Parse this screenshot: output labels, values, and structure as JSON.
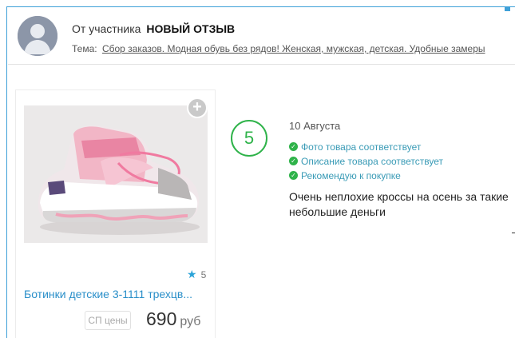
{
  "header": {
    "from_label": "От участника",
    "author": "НОВЫЙ ОТЗЫВ",
    "topic_label": "Тема:",
    "topic_link": "Сбор заказов. Модная обувь без рядов! Женская, мужская, детская. Удобные замеры"
  },
  "product": {
    "rating": "5",
    "title": "Ботинки детские 3-1111 трехцв...",
    "price_badge": "СП цены",
    "price": "690",
    "currency": "руб",
    "add_icon": "plus-icon",
    "rating_icon": "star-icon"
  },
  "review": {
    "score": "5",
    "date": "10 Августа",
    "checks": [
      "Фото товара соответствует",
      "Описание товара соответствует",
      "Рекомендую к покупке"
    ],
    "text": "Очень неплохие кроссы на осень за такие небольшие деньги"
  },
  "colors": {
    "accent": "#2a8fc9",
    "frame": "#3ea0d8",
    "positive": "#2fb34a"
  }
}
